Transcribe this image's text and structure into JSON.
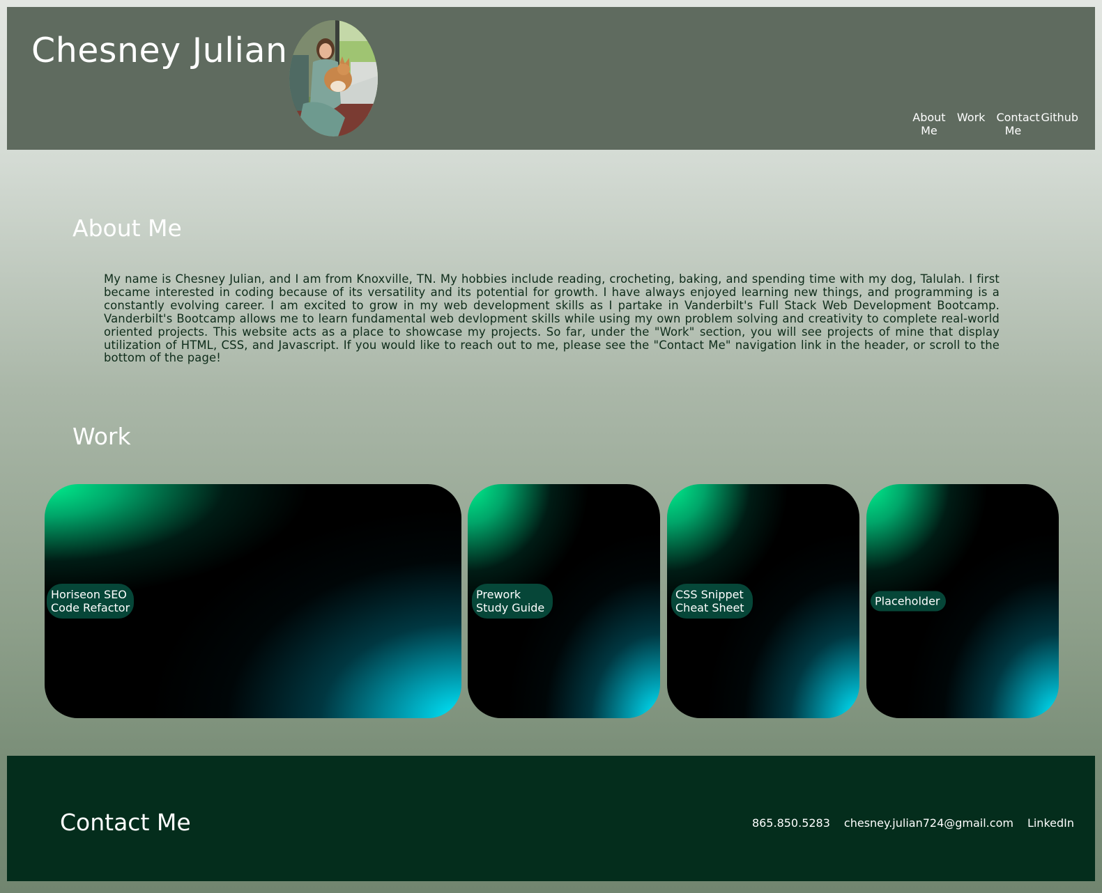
{
  "header": {
    "title": "Chesney Julian",
    "nav": [
      {
        "label": "About Me"
      },
      {
        "label": "Work"
      },
      {
        "label": "Contact Me"
      },
      {
        "label": "Github"
      }
    ]
  },
  "about": {
    "title": "About Me",
    "text": "My name is Chesney Julian, and I am from Knoxville, TN. My hobbies include reading, crocheting, baking, and spending time with my dog, Talulah. I first became interested in coding because of its versatility and its potential for growth. I have always enjoyed learning new things, and programming is a constantly evolving career. I am excited to grow in my web development skills as I partake in Vanderbilt's Full Stack Web Development Bootcamp. Vanderbilt's Bootcamp allows me to learn fundamental web devlopment skills while using my own problem solving and creativity to complete real-world oriented projects. This website acts as a place to showcase my projects. So far, under the \"Work\" section, you will see projects of mine that display utilization of HTML, CSS, and Javascript. If you would like to reach out to me, please see the \"Contact Me\" navigation link in the header, or scroll to the bottom of the page!"
  },
  "work": {
    "title": "Work",
    "projects": [
      {
        "line1": "Horiseon SEO",
        "line2": "Code Refactor"
      },
      {
        "line1": "Prework",
        "line2": "Study Guide"
      },
      {
        "line1": "CSS Snippet",
        "line2": "Cheat Sheet"
      },
      {
        "line1": "Placeholder",
        "line2": ""
      }
    ]
  },
  "contact": {
    "title": "Contact Me",
    "phone": "865.850.5283",
    "email": "chesney.julian724@gmail.com",
    "linkedin": "LinkedIn"
  },
  "colors": {
    "header_bg": "#5f6b5f",
    "footer_bg": "#042d1c",
    "accent_green": "#00f28f",
    "accent_cyan": "#00eaff"
  }
}
